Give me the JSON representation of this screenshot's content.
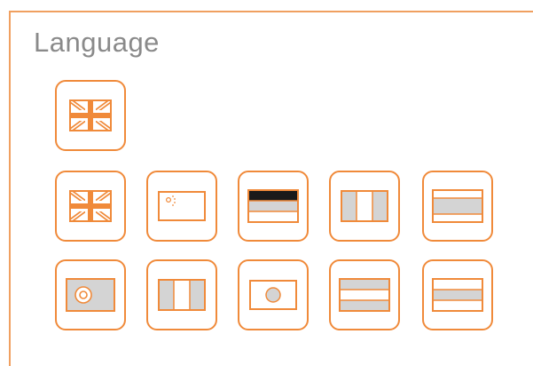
{
  "section": {
    "title": "Language"
  },
  "current_language": {
    "flag": "uk-flag-icon"
  },
  "language_options": [
    {
      "flag": "uk-flag-icon"
    },
    {
      "flag": "china-flag-icon"
    },
    {
      "flag": "germany-flag-icon"
    },
    {
      "flag": "italy-flag-icon"
    },
    {
      "flag": "spain-flag-icon"
    },
    {
      "flag": "brazil-flag-icon"
    },
    {
      "flag": "france-flag-icon"
    },
    {
      "flag": "japan-flag-icon"
    },
    {
      "flag": "netherlands-flag-icon"
    },
    {
      "flag": "russia-flag-icon"
    }
  ],
  "colors": {
    "accent": "#f08a3a",
    "panel_border": "#f0a060",
    "flag_fill": "#d4d4d4",
    "flag_dark": "#1a1a1a",
    "title_text": "#8a8a8a"
  }
}
